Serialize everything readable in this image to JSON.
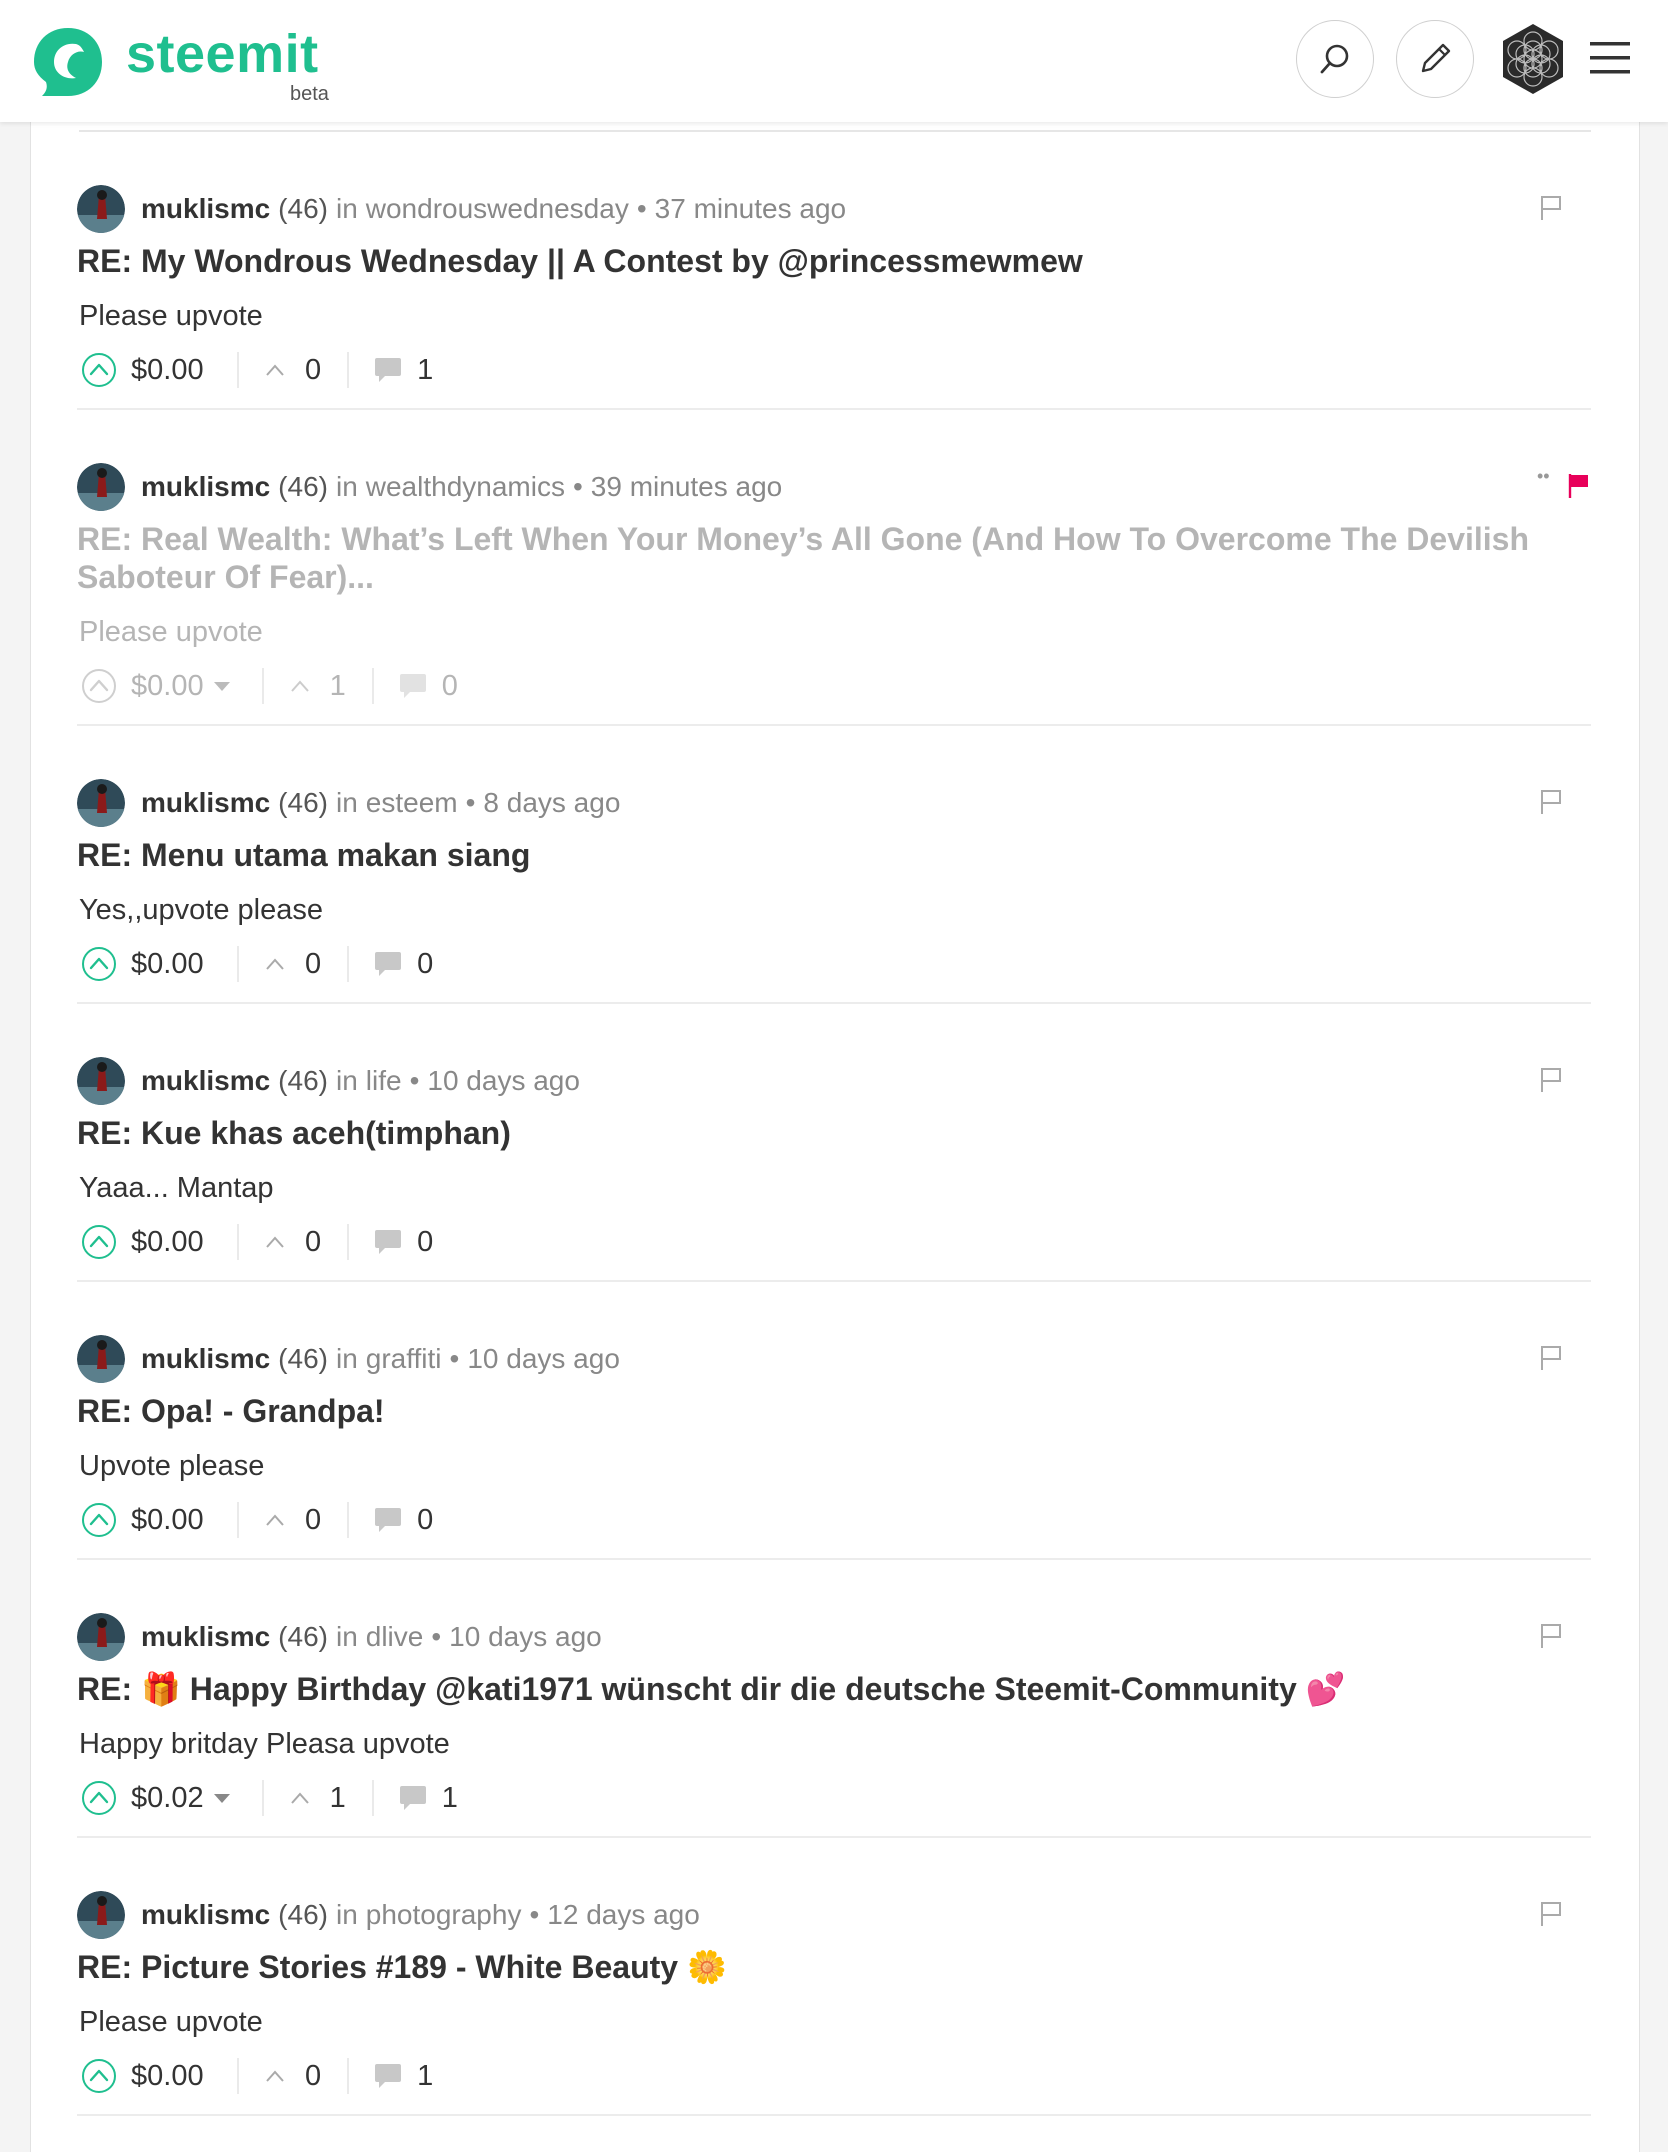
{
  "header": {
    "logo_text": "steemit",
    "logo_badge": "beta",
    "brand_color": "#1fbf8f",
    "search_icon": "search-icon",
    "edit_icon": "pencil-icon",
    "menu_icon": "hamburger-menu-icon"
  },
  "colors": {
    "flag_active": "#e8005a",
    "upvote_green": "#1fbf8f"
  },
  "items": [
    {
      "author": "muklismc",
      "reputation": "(46)",
      "in_label": "in",
      "category": "wondrouswednesday",
      "separator": "•",
      "time": "37 minutes ago",
      "title": "RE: My Wondrous Wednesday || A Contest by @princessmewmew",
      "body": "Please upvote",
      "payout": "$0.00",
      "votes": "0",
      "comments": "1"
    },
    {
      "author": "muklismc",
      "reputation": "(46)",
      "in_label": "in",
      "category": "wealthdynamics",
      "separator": "•",
      "time": "39 minutes ago",
      "title": "RE: Real Wealth: What’s Left When Your Money’s All Gone (And How To Overcome The Devilish Saboteur Of Fear)...",
      "body": "Please upvote",
      "payout": "$0.00",
      "votes": "1",
      "comments": "0",
      "flag_dots": "••"
    },
    {
      "author": "muklismc",
      "reputation": "(46)",
      "in_label": "in",
      "category": "esteem",
      "separator": "•",
      "time": "8 days ago",
      "title": "RE: Menu utama makan siang",
      "body": "Yes,,upvote please",
      "payout": "$0.00",
      "votes": "0",
      "comments": "0"
    },
    {
      "author": "muklismc",
      "reputation": "(46)",
      "in_label": "in",
      "category": "life",
      "separator": "•",
      "time": "10 days ago",
      "title": "RE: Kue khas aceh(timphan)",
      "body": "Yaaa... Mantap",
      "payout": "$0.00",
      "votes": "0",
      "comments": "0"
    },
    {
      "author": "muklismc",
      "reputation": "(46)",
      "in_label": "in",
      "category": "graffiti",
      "separator": "•",
      "time": "10 days ago",
      "title": "RE: Opa! - Grandpa!",
      "body": "Upvote please",
      "payout": "$0.00",
      "votes": "0",
      "comments": "0"
    },
    {
      "author": "muklismc",
      "reputation": "(46)",
      "in_label": "in",
      "category": "dlive",
      "separator": "•",
      "time": "10 days ago",
      "title_prefix": "RE:",
      "title_emoji_1": "🎁",
      "title_main": "Happy Birthday @kati1971 wünscht dir die deutsche Steemit-Community",
      "title_emoji_2": "💕",
      "body": "Happy britday Pleasa upvote",
      "payout": "$0.02",
      "votes": "1",
      "comments": "1"
    },
    {
      "author": "muklismc",
      "reputation": "(46)",
      "in_label": "in",
      "category": "photography",
      "separator": "•",
      "time": "12 days ago",
      "title_main": "RE: Picture Stories #189 - White Beauty",
      "title_emoji": "🌼",
      "body": "Please upvote",
      "payout": "$0.00",
      "votes": "0",
      "comments": "1"
    }
  ]
}
